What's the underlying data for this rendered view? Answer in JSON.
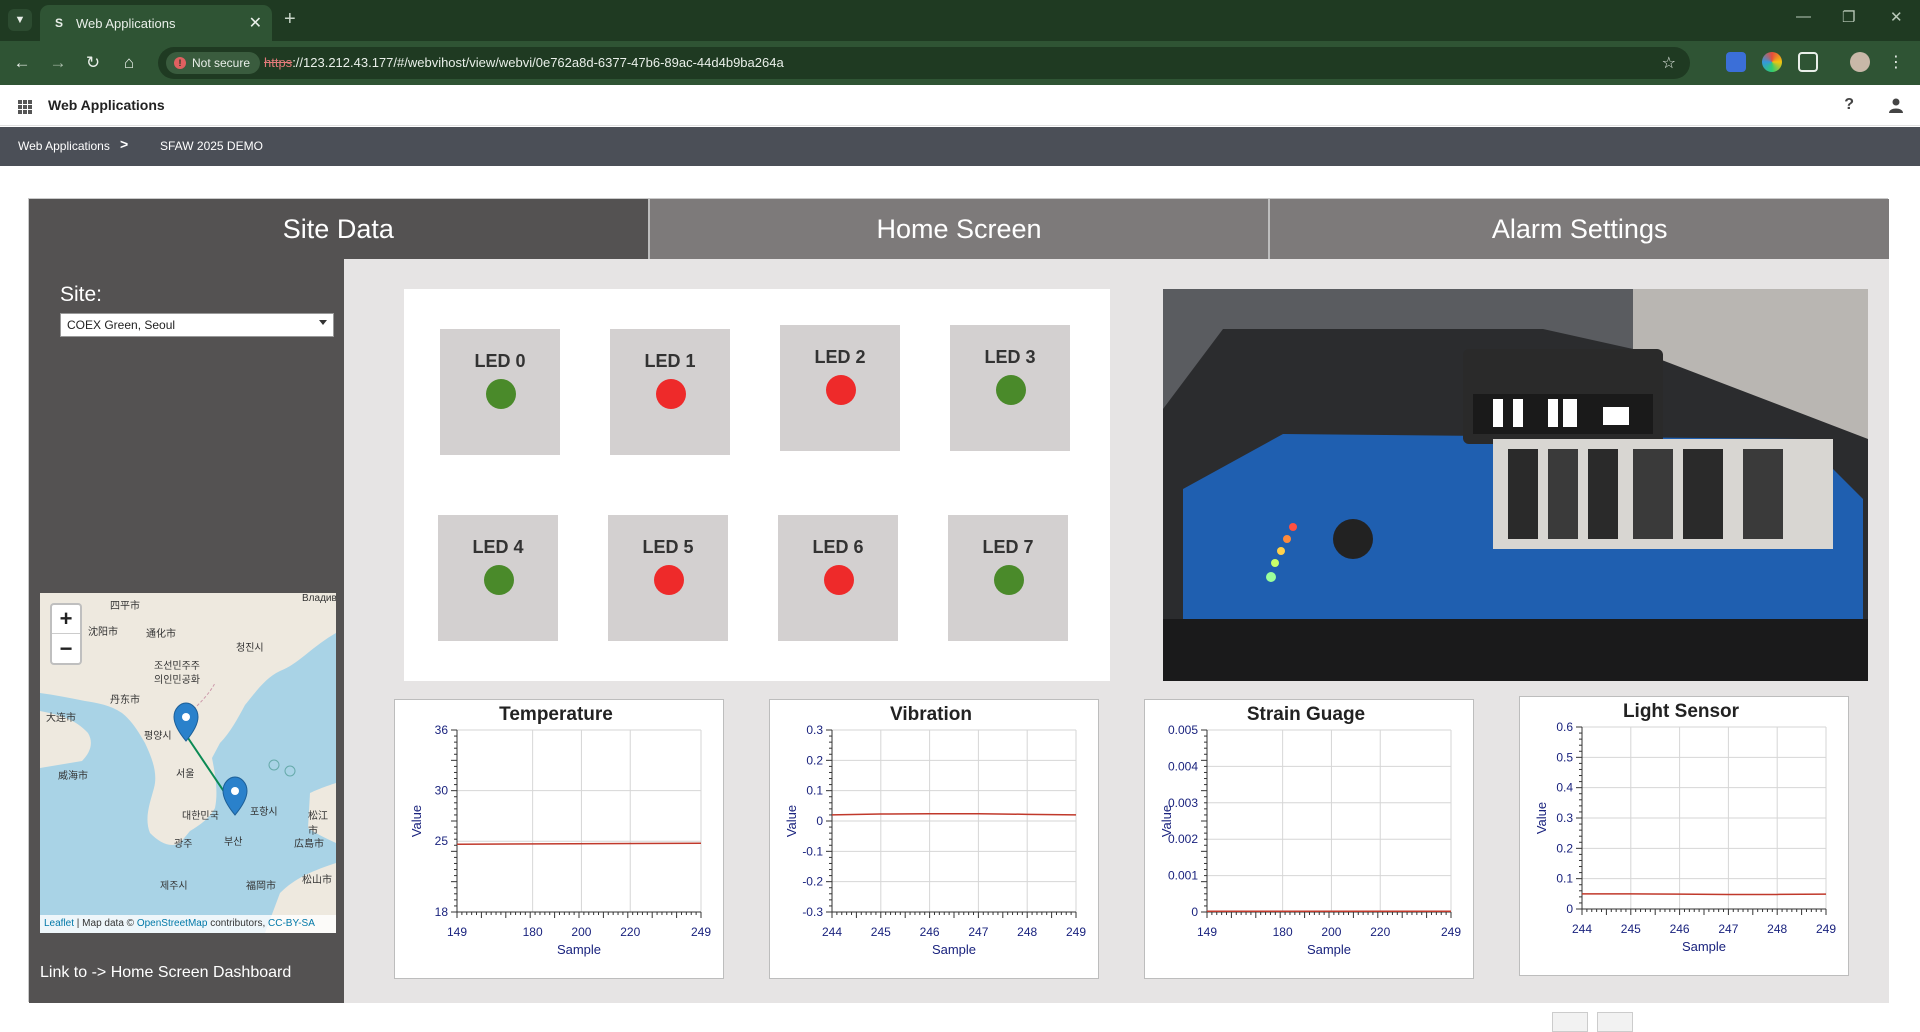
{
  "browser": {
    "tab_title": "Web Applications",
    "not_secure": "Not secure",
    "url_scheme": "https",
    "url_rest": "://123.212.43.177/#/webvihost/view/webvi/0e762a8d-6377-47b6-89ac-44d4b9ba264a"
  },
  "app": {
    "title": "Web Applications",
    "help": "?"
  },
  "breadcrumb": {
    "root": "Web Applications",
    "separator": ">",
    "current": "SFAW 2025 DEMO"
  },
  "tabs": [
    {
      "label": "Site Data",
      "active": true
    },
    {
      "label": "Home Screen",
      "active": false
    },
    {
      "label": "Alarm Settings",
      "active": false
    }
  ],
  "sidebar": {
    "site_label": "Site:",
    "site_value": "COEX Green, Seoul",
    "home_link": "Link to -> Home Screen Dashboard"
  },
  "map": {
    "zoom_in": "+",
    "zoom_out": "−",
    "attr_leaflet": "Leaflet",
    "attr_sep": " | Map data © ",
    "attr_osm": "OpenStreetMap",
    "attr_contrib": " contributors, ",
    "attr_license": "CC-BY-SA",
    "labels": [
      "四平市",
      "沈阳市",
      "通化市",
      "청진시",
      "조선민주주",
      "의인민공화",
      "丹东市",
      "평양시",
      "大连市",
      "서울",
      "威海市",
      "대한민국",
      "포항시",
      "광주",
      "부산",
      "제주시",
      "福岡市",
      "広島市",
      "松江市",
      "松山市",
      "Владивосток"
    ]
  },
  "leds": [
    {
      "label": "LED 0",
      "state": "green"
    },
    {
      "label": "LED 1",
      "state": "red"
    },
    {
      "label": "LED 2",
      "state": "red"
    },
    {
      "label": "LED 3",
      "state": "green"
    },
    {
      "label": "LED 4",
      "state": "green"
    },
    {
      "label": "LED 5",
      "state": "red"
    },
    {
      "label": "LED 6",
      "state": "red"
    },
    {
      "label": "LED 7",
      "state": "green"
    }
  ],
  "colors": {
    "led_green": "#4a8a2a",
    "led_red": "#ee2a2a",
    "trace": "#c0392b",
    "axis_text": "#1a237e"
  },
  "chart_data": [
    {
      "type": "line",
      "title": "Temperature",
      "xlabel": "Sample",
      "ylabel": "Value",
      "xticks": [
        149,
        180,
        200,
        220,
        249
      ],
      "xlim": [
        149,
        249
      ],
      "yticks": [
        18,
        25,
        30,
        36
      ],
      "ylim": [
        18,
        36
      ],
      "series": [
        {
          "x": [
            149,
            249
          ],
          "values": [
            24.7,
            24.8
          ]
        }
      ]
    },
    {
      "type": "line",
      "title": "Vibration",
      "xlabel": "Sample",
      "ylabel": "Value",
      "xticks": [
        244,
        245,
        246,
        247,
        248,
        249
      ],
      "xlim": [
        244,
        249
      ],
      "yticks": [
        -0.3,
        -0.2,
        -0.1,
        0,
        0.1,
        0.2,
        0.3
      ],
      "ylim": [
        -0.3,
        0.3
      ],
      "series": [
        {
          "x": [
            244,
            245,
            246,
            247,
            248,
            249
          ],
          "values": [
            0.02,
            0.023,
            0.024,
            0.024,
            0.022,
            0.02
          ]
        }
      ]
    },
    {
      "type": "line",
      "title": "Strain Guage",
      "xlabel": "Sample",
      "ylabel": "Value",
      "xticks": [
        149,
        180,
        200,
        220,
        249
      ],
      "xlim": [
        149,
        249
      ],
      "yticks": [
        0,
        0.001,
        0.002,
        0.003,
        0.004,
        0.005
      ],
      "ylim": [
        0,
        0.005
      ],
      "series": [
        {
          "x": [
            149,
            249
          ],
          "values": [
            2e-05,
            2e-05
          ]
        }
      ]
    },
    {
      "type": "line",
      "title": "Light Sensor",
      "xlabel": "Sample",
      "ylabel": "Value",
      "xticks": [
        244,
        245,
        246,
        247,
        248,
        249
      ],
      "xlim": [
        244,
        249
      ],
      "yticks": [
        0,
        0.1,
        0.2,
        0.3,
        0.4,
        0.5,
        0.6
      ],
      "ylim": [
        0,
        0.6
      ],
      "series": [
        {
          "x": [
            244,
            245,
            246,
            247,
            248,
            249
          ],
          "values": [
            0.05,
            0.05,
            0.049,
            0.048,
            0.048,
            0.049
          ]
        }
      ]
    }
  ]
}
